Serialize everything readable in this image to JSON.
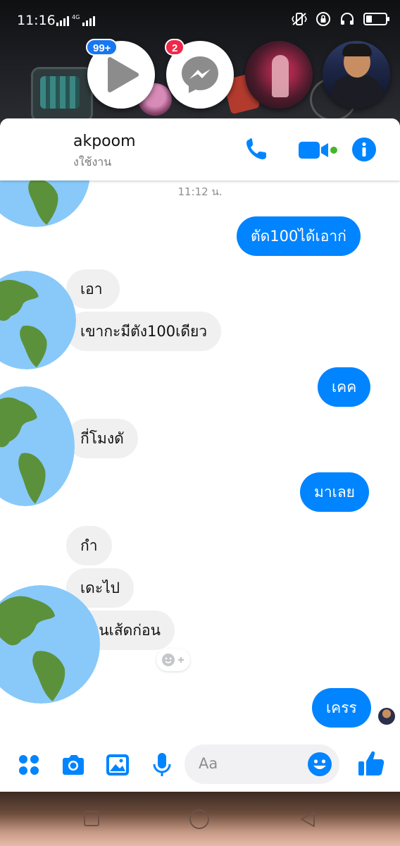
{
  "status_bar": {
    "time": "11:16",
    "network": "4G"
  },
  "chat_heads": [
    {
      "name": "video-app-head",
      "badge": "99+"
    },
    {
      "name": "messenger-head",
      "badge": "2"
    },
    {
      "name": "contact-head-1"
    },
    {
      "name": "contact-head-2"
    }
  ],
  "header": {
    "contact_name": "akpoom",
    "contact_status": "งใช้งาน"
  },
  "conversation": {
    "timestamp": "11:12 น.",
    "messages": [
      {
        "side": "out",
        "text": "ตัด100ได้เอาก่"
      },
      {
        "side": "in",
        "text": "เอา"
      },
      {
        "side": "in",
        "text": "เขากะมีตัง100เดียว"
      },
      {
        "side": "out",
        "text": "เคค"
      },
      {
        "side": "in",
        "text": "กี่โมงดั"
      },
      {
        "side": "out",
        "text": "มาเลย"
      },
      {
        "side": "in",
        "text": "กำ"
      },
      {
        "side": "in",
        "text": "เดะไป"
      },
      {
        "side": "in",
        "text": "ยนเส้ดก่อน"
      },
      {
        "side": "out",
        "text": "เครร"
      }
    ]
  },
  "composer": {
    "placeholder": "Aa"
  },
  "colors": {
    "accent": "#0084ff",
    "incoming_bubble": "#f0f0f0",
    "online_dot": "#42b72a",
    "badge_blue": "#1877f2",
    "badge_red": "#f02849"
  }
}
